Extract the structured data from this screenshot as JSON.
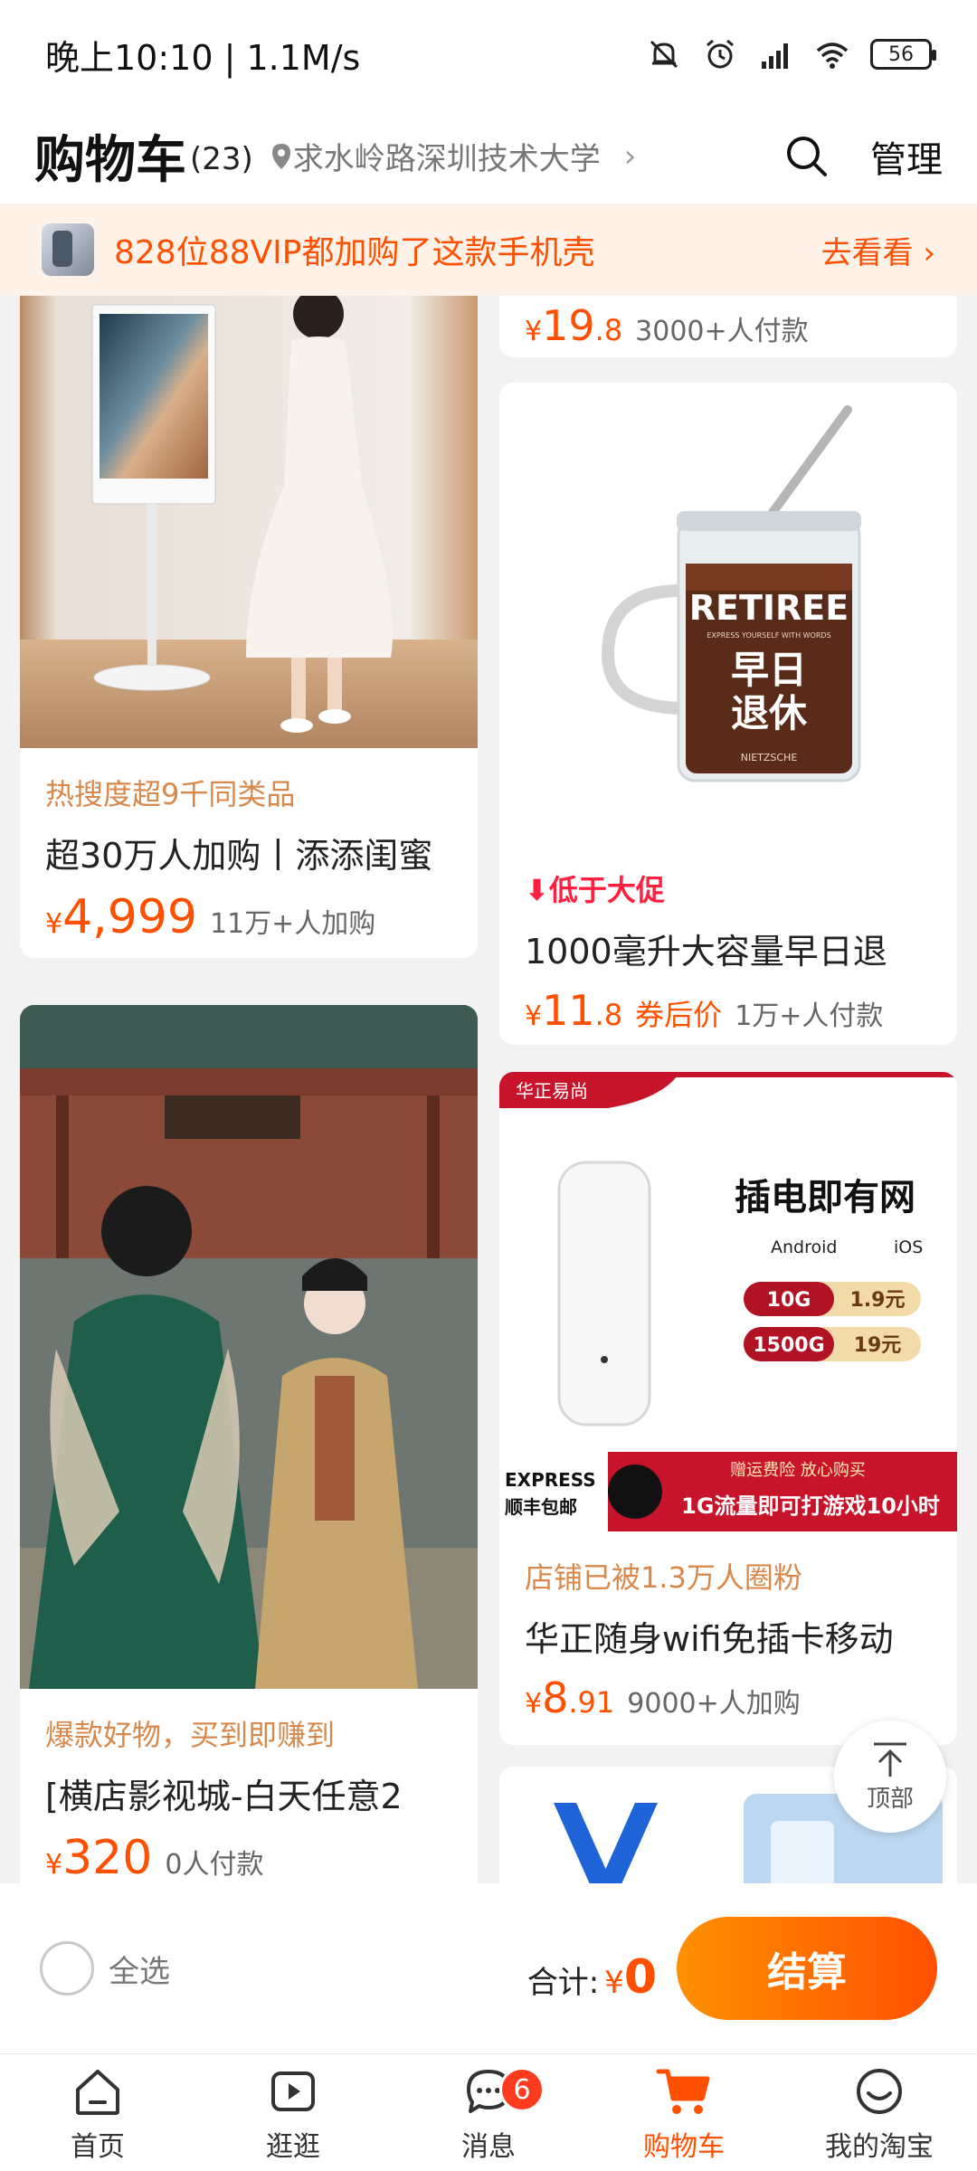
{
  "status_bar": {
    "time_speed": "晚上10:10 | 1.1M/s",
    "battery": "56",
    "icons": [
      "mute-bell-icon",
      "alarm-icon",
      "hd-signal-icon",
      "wifi-icon",
      "battery-icon"
    ]
  },
  "header": {
    "title": "购物车",
    "count": "(23)",
    "location": "求水岭路深圳技术大学",
    "manage": "管理"
  },
  "promo": {
    "text": "828位88VIP都加购了这款手机壳",
    "link": "去看看"
  },
  "products": {
    "card_top_right": {
      "price_int": "19",
      "price_dec": ".8",
      "sales": "3000+人付款"
    },
    "card_tv_stand": {
      "tag": "热搜度超9千同类品",
      "title": "超30万人加购丨添添闺蜜",
      "price_int": "4,999",
      "sales": "11万+人加购"
    },
    "card_cup": {
      "tag": "低于大促",
      "title": "1000毫升大容量早日退",
      "price_int": "11",
      "price_dec": ".8",
      "coupon": "券后价",
      "sales": "1万+人付款",
      "image_text": {
        "brand": "RETIREE",
        "small": "EXPRESS YOURSELF WITH WORDS",
        "cn1": "早日",
        "cn2": "退休",
        "footer": "NIETZSCHE"
      }
    },
    "card_hanfu": {
      "tag": "爆款好物，买到即赚到",
      "title": "[横店影视城-白天任意2",
      "price_int": "320",
      "sales": "0人付款"
    },
    "card_wifi": {
      "tag": "店铺已被1.3万人圈粉",
      "title": "华正随身wifi免插卡移动",
      "price_int": "8",
      "price_dec": ".91",
      "sales": "9000+人加购",
      "image_text": {
        "brand": "华正易尚",
        "headline": "插电即有网",
        "android": "Android",
        "ios": "iOS",
        "plan1_size": "10G",
        "plan1_price": "1.9元",
        "plan2_size": "1500G",
        "plan2_price": "19元",
        "express": "EXPRESS",
        "shipping": "顺丰包邮",
        "insurance": "赠运费险 放心购买",
        "banner": "1G流量即可打游戏10小时"
      }
    }
  },
  "to_top": "顶部",
  "checkout": {
    "select_all": "全选",
    "total_label": "合计:",
    "currency": "¥",
    "total_value": "0",
    "button": "结算"
  },
  "tabs": [
    {
      "label": "首页",
      "icon": "home-icon"
    },
    {
      "label": "逛逛",
      "icon": "video-icon"
    },
    {
      "label": "消息",
      "icon": "message-icon",
      "badge": "6"
    },
    {
      "label": "购物车",
      "icon": "cart-icon"
    },
    {
      "label": "我的淘宝",
      "icon": "smile-face-icon"
    }
  ],
  "colors": {
    "accent": "#ff5000",
    "tag_orange": "#d8884b",
    "tag_red": "#ff1f3e",
    "background": "#f2f2f2"
  }
}
